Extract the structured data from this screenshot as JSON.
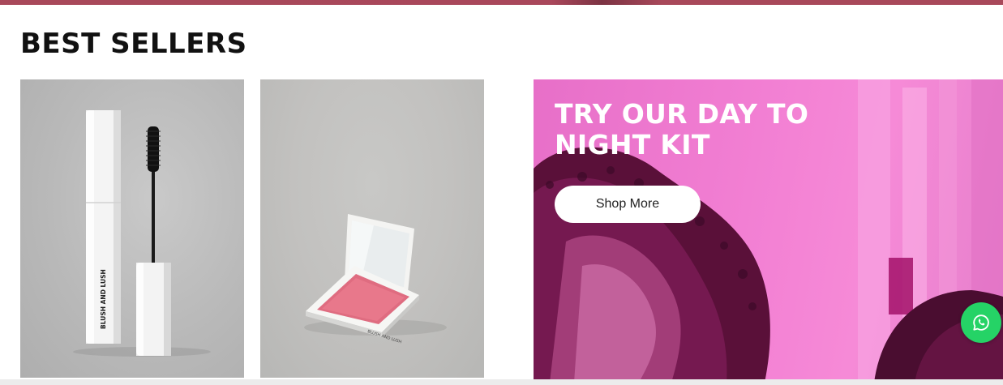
{
  "section": {
    "title": "BEST SELLERS"
  },
  "products": [
    {
      "image_name": "mascara-product-image",
      "brand_text": "BLUSH AND LUSH"
    },
    {
      "image_name": "blush-compact-product-image",
      "brand_text": "BLUSH AND LUSH"
    }
  ],
  "promo": {
    "heading": "TRY OUR DAY TO NIGHT KIT",
    "button_label": "Shop More"
  },
  "chat": {
    "icon": "whatsapp-icon"
  },
  "colors": {
    "accent_strip": "#a8485a",
    "promo_pink": "#f27fd3",
    "whatsapp_green": "#25d366"
  }
}
